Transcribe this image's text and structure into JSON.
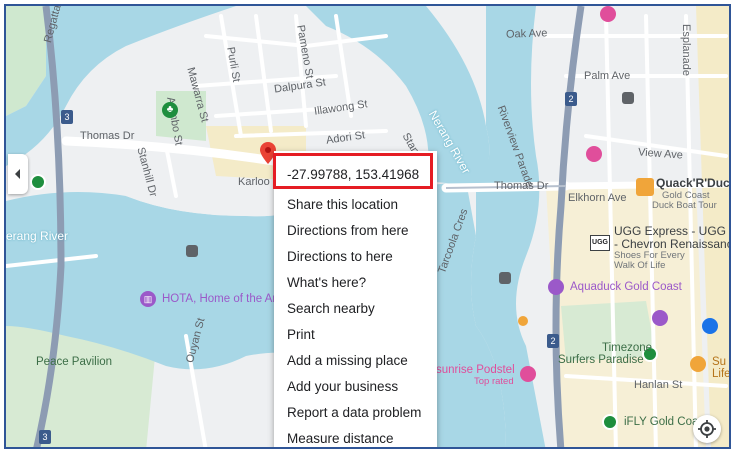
{
  "map": {
    "streets": {
      "regatta_parade": "Regatta Parade",
      "mawarra_st": "Mawarra St",
      "purli_st": "Purli St",
      "pamene_st": "Pameno St",
      "arenbo_st": "Arenbo St",
      "dalpura_st": "Dalpura St",
      "illawong_st": "Illawong St",
      "adori_st": "Adori St",
      "thomas_dr_left": "Thomas Dr",
      "thomas_dr_right": "Thomas Dr",
      "stanhill_dr": "Stanhill Dr",
      "karloo": "Karloo",
      "tarcoola_cres": "Tarcoola Cres",
      "oak_ave": "Oak Ave",
      "palm_ave": "Palm Ave",
      "view_ave": "View Ave",
      "riverview_parade": "Riverview Parade",
      "elkhorn_ave": "Elkhorn Ave",
      "esplanade": "Esplanade",
      "hanlan_st": "Hanlan St",
      "ouyan_st": "Ouyan St",
      "stan": "Stan"
    },
    "water": {
      "nerang_river_left": "erang River",
      "nerang_river_right": "Nerang River"
    },
    "places": {
      "peace_pavilion": "Peace Pavilion",
      "hota": "HOTA, Home of the Arts",
      "quackrduck_title": "Quack'R'Duck",
      "quackrduck_sub1": "Gold Coast",
      "quackrduck_sub2": "Duck Boat Tour",
      "ugg_line1": "UGG Express - UGG Boo",
      "ugg_line2": "- Chevron Renaissance",
      "ugg_sub1": "Shoes For Every",
      "ugg_sub2": "Walk Of Life",
      "ugg_logo": "UGG",
      "aquaduck": "Aquaduck Gold Coast",
      "timezone_line1": "Timezone",
      "timezone_line2": "Surfers Paradise",
      "sunrise": "sunrise Podstel",
      "sunrise_sub": "Top rated",
      "ifly": "iFLY Gold Coa",
      "su_line1": "Su",
      "su_line2": "Life"
    },
    "route_shields": [
      "3",
      "3",
      "2",
      "2"
    ],
    "colors": {
      "water": "#a8d7e6",
      "park": "#cfe8cf",
      "road": "#ffffff",
      "highway": "#8d9cb3",
      "beach": "#f4ebc8",
      "pin": "#ea4335",
      "poi_pink": "#e04e9b",
      "poi_purple": "#9b59c9",
      "poi_green": "#1e8e3e",
      "highlight": "#e51c23"
    }
  },
  "context_menu": {
    "coordinates": "-27.99788, 153.41968",
    "items": [
      "Share this location",
      "Directions from here",
      "Directions to here",
      "What's here?",
      "Search nearby",
      "Print",
      "Add a missing place",
      "Add your business",
      "Report a data problem",
      "Measure distance"
    ]
  },
  "controls": {
    "collapse_icon": "chevron-left-icon",
    "locate_icon": "my-location-icon"
  }
}
